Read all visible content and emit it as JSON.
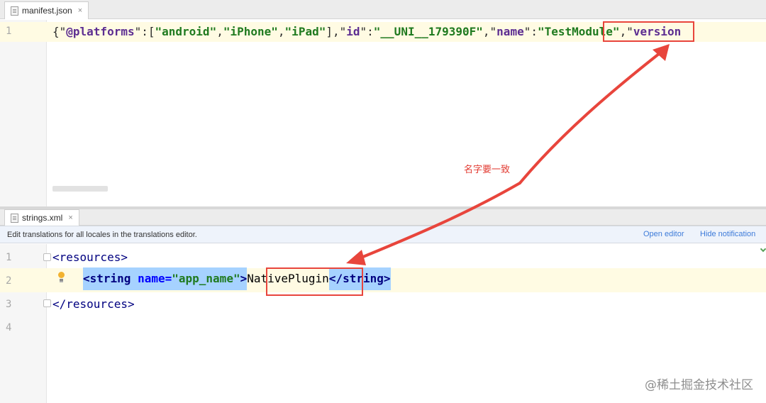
{
  "top_editor": {
    "tab": {
      "filename": "manifest.json",
      "close": "×"
    },
    "line_number": "1",
    "code": {
      "p1": "{\"",
      "k1": "@platforms",
      "p2": "\":[",
      "s1": "\"android\"",
      "p3": ",",
      "s2": "\"iPhone\"",
      "p4": ",",
      "s3": "\"iPad\"",
      "p5": "],\"",
      "k2": "id",
      "p6": "\":",
      "s4": "\"__UNI__179390F\"",
      "p7": ",\"",
      "k3": "name",
      "p8": "\":",
      "s5": "\"TestModule\"",
      "p9": ",\"",
      "k4": "version"
    }
  },
  "bottom_editor": {
    "tab": {
      "filename": "strings.xml",
      "close": "×"
    },
    "notification": {
      "message": "Edit translations for all locales in the translations editor.",
      "open_editor": "Open editor",
      "hide_notification": "Hide notification"
    },
    "line_numbers": [
      "1",
      "2",
      "3",
      "4"
    ],
    "lines": {
      "l1": "<resources>",
      "l2_open_tag": "<string",
      "l2_attr": "name=",
      "l2_attr_value": "\"app_name\"",
      "l2_gt": ">",
      "l2_text": "NativePlugin",
      "l2_close_tag": "</string>",
      "l3": "</resources>"
    }
  },
  "annotation": {
    "text": "名字要一致",
    "color": "#e23b32"
  },
  "watermark": "@稀土掘金技术社区",
  "colors": {
    "highlight_box": "#e8453c",
    "selection": "#a6d2ff",
    "current_line": "#fffbe3",
    "link": "#3d7bd9"
  }
}
